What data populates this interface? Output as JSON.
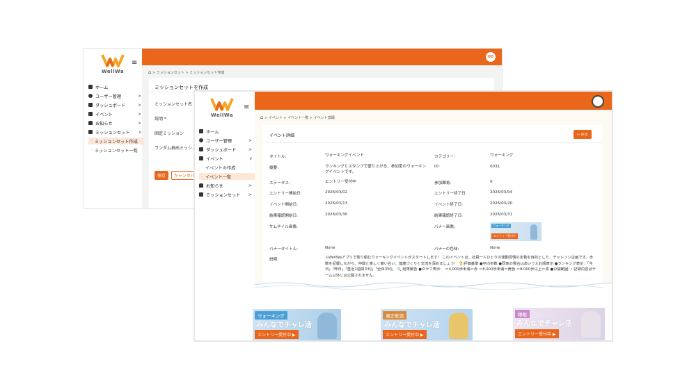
{
  "back_window": {
    "brand": "WellWa",
    "avatar_initials": "UO",
    "breadcrumb": "> ミッションセット > ミッションセット作成",
    "nav": [
      {
        "label": "ホーム",
        "chevron": ""
      },
      {
        "label": "ユーザー管理",
        "chevron": ">"
      },
      {
        "label": "ダッシュボード",
        "chevron": ">"
      },
      {
        "label": "イベント",
        "chevron": ">"
      },
      {
        "label": "お知らせ",
        "chevron": ">"
      },
      {
        "label": "ミッションセット",
        "chevron": "v"
      }
    ],
    "sub_nav": [
      "ミッションセット作成",
      "ミッションセット一覧"
    ],
    "card_title": "ミッションセットを作成",
    "fields": [
      "ミッションセット名 *",
      "説明 *",
      "固定ミッション",
      "ランダム抽出ミッション"
    ],
    "save_label": "保存",
    "cancel_label": "キャンセル"
  },
  "front_window": {
    "brand": "WellWa",
    "breadcrumb": "> イベント > イベント一覧 > イベント詳細",
    "nav": [
      {
        "label": "ホーム",
        "chevron": ""
      },
      {
        "label": "ユーザー管理",
        "chevron": ">"
      },
      {
        "label": "ダッシュボード",
        "chevron": ">"
      },
      {
        "label": "イベント",
        "chevron": "v"
      }
    ],
    "sub_nav": [
      "イベントの作成",
      "イベント一覧"
    ],
    "nav_after": [
      {
        "label": "お知らせ",
        "chevron": ">"
      },
      {
        "label": "ミッションセット",
        "chevron": ">"
      }
    ],
    "card_title": "イベント詳細",
    "back_label": "← 戻る",
    "details": {
      "title_label": "タイトル:",
      "title_value": "ウォーキングイベント",
      "category_label": "カテゴリー:",
      "category_value": "ウォーキング",
      "summary_label": "概要:",
      "summary_value": "ランキングとスタンプで盛り上がる、参加型のウォーキングイベントです。",
      "id_label": "ID:",
      "id_value": "0031",
      "status_label": "ステータス:",
      "status_value": "エントリー受付中",
      "difficulty_label": "参加難易:",
      "difficulty_value": "0",
      "entry_start_label": "エントリー開始日:",
      "entry_start_value": "2026/03/02",
      "entry_end_label": "エントリー終了日:",
      "entry_end_value": "2026/03/04",
      "event_start_label": "イベント開始日:",
      "event_start_value": "2026/03/13",
      "event_end_label": "イベント終了日:",
      "event_end_value": "2026/03/20",
      "result_start_label": "結果確認開始日:",
      "result_start_value": "2026/03/30",
      "result_end_label": "結果確認終了日:",
      "result_end_value": "2026/03/31",
      "thumb_label": "サムネイル画像:",
      "banner_label": "バナー画像:",
      "banner_title_label": "バナータイトル:",
      "banner_title_value": "None",
      "banner_color_label": "バナーの色味:",
      "banner_color_value": "None",
      "description_label": "説明:",
      "description_value": "⚠WellWaアプリで取り組むウォーキングイベントがスタートします！ このイベントは、社員一人ひとりの運動習慣の定着を目的とした、チャレンジ企画です。歩数を記録しながら、仲間と楽しく競い合い、健康づくりと交流を深めましょう！ 🏆評価基準 ●平均歩数 ●同率の場合はあいうえお順表示 ●ランキング表示：「今日」「昨日」「直近1週間平均」「全体平均」 🔍 結果報告 ●グラフ表示： ＝4,000歩未満＝赤 ＝8,000歩未満＝黄色 ＝8,000歩以上＝青 ●公開範囲：・記録内容はチーム以外には公開されません。"
    },
    "thumb_tag": "ウォーキング",
    "thumb_button": "エントリー受付中"
  },
  "banners": [
    {
      "tag": "ウォーキング",
      "headline": "みんなでチャレ活",
      "entry": "エントリー受付中 ▶",
      "tag_color": "#4aa0d6",
      "bg1": "#cfe3f3",
      "bg2": "#a9cde8",
      "figure_color": "#8fb8d9"
    },
    {
      "tag": "適正飲酒",
      "headline": "みんなでチャレ活",
      "entry": "エントリー受付中 ▶",
      "tag_color": "#d88a3a",
      "bg1": "#cde2f3",
      "bg2": "#b5d4ee",
      "figure_color": "#e8c46a"
    },
    {
      "tag": "睡眠",
      "headline": "みんなでチャレ活",
      "entry": "エントリー受付中 ▶",
      "tag_color": "#c98ac9",
      "bg1": "#efe6f2",
      "bg2": "#dcd2e6",
      "figure_color": "#e7e1ea"
    }
  ],
  "colors": {
    "accent": "#e9661a"
  }
}
